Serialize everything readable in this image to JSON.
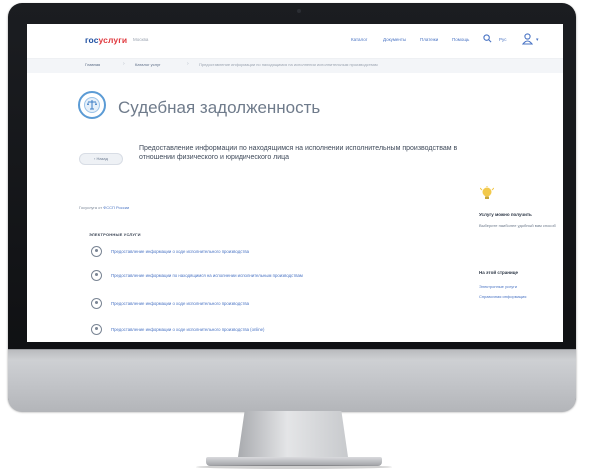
{
  "header": {
    "logo_part1": "гос",
    "logo_part2": "услуги",
    "location": "Москва",
    "nav": [
      "Каталог",
      "Документы",
      "Платежи",
      "Помощь"
    ],
    "language": "Рус",
    "search_icon": "search-icon",
    "user_icon": "user-icon"
  },
  "breadcrumbs": [
    "Главная",
    "Каталог услуг",
    "Предоставление информации по находящимся на исполнении исполнительным производствам"
  ],
  "page": {
    "title": "Судебная задолженность",
    "back_label": "‹ Назад",
    "service_description": "Предоставление информации по находящимся на исполнении исполнительным производствам в отношении физического и юридического лица",
    "owner_label": "Госуслуга от",
    "owner_link": "ФССП России"
  },
  "services": {
    "heading": "ЭЛЕКТРОННЫЕ УСЛУГИ",
    "items": [
      "Предоставление информации о ходе исполнительного производства",
      "Предоставление информации по находящимся на исполнении исполнительным производствам",
      "Предоставление информации о ходе исполнительного производства",
      "Предоставление информации о ходе исполнительного производства (online)"
    ]
  },
  "aside": {
    "title": "Услугу можно получить",
    "text": "Выберите наиболее удобный вам способ",
    "on_page_title": "На этой странице",
    "links": [
      "Электронные услуги",
      "Справочная информация"
    ]
  },
  "colors": {
    "brand_blue": "#1e4fa1",
    "brand_red": "#e0393e",
    "link": "#4a74c4"
  }
}
